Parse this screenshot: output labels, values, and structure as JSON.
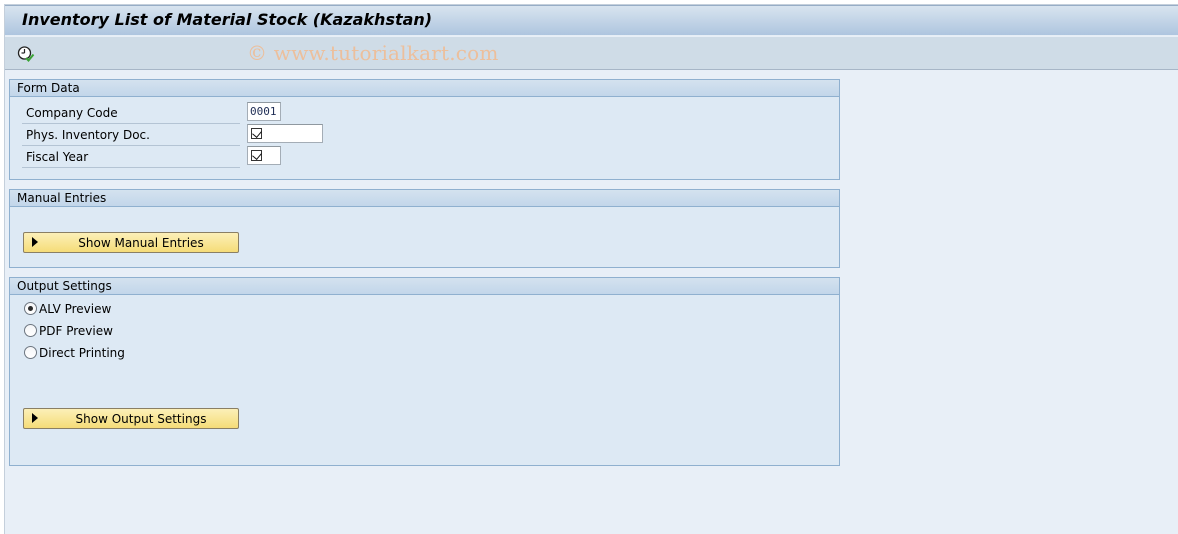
{
  "window": {
    "title": "Inventory List of Material Stock (Kazakhstan)"
  },
  "toolbar": {
    "execute_icon": "execute-clock-check-icon",
    "watermark": "© www.tutorialkart.com"
  },
  "form_data": {
    "header": "Form Data",
    "fields": [
      {
        "label": "Company Code",
        "value": "0001",
        "type": "text"
      },
      {
        "label": "Phys. Inventory Doc.",
        "value": "",
        "type": "checkbox-required"
      },
      {
        "label": "Fiscal Year",
        "value": "",
        "type": "checkbox-required"
      }
    ]
  },
  "manual_entries": {
    "header": "Manual Entries",
    "button_label": "Show Manual Entries"
  },
  "output_settings": {
    "header": "Output Settings",
    "options": [
      {
        "label": "ALV Preview",
        "selected": true
      },
      {
        "label": "PDF Preview",
        "selected": false
      },
      {
        "label": "Direct Printing",
        "selected": false
      }
    ],
    "button_label": "Show Output Settings"
  },
  "colors": {
    "background": "#e8eff7",
    "group_background": "#dde9f4",
    "group_border": "#8fb0cf",
    "button": "#f5dc78",
    "watermark": "#ecbf9c"
  }
}
